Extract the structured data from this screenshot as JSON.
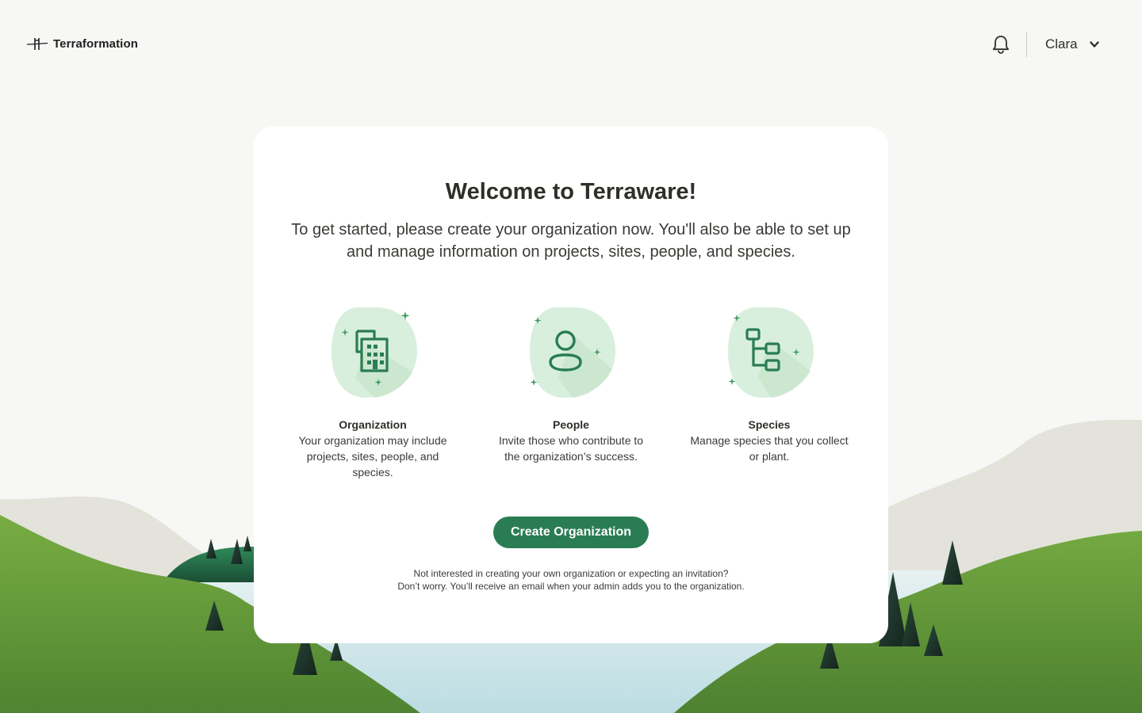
{
  "header": {
    "logo_text": "Terraformation",
    "user_name": "Clara"
  },
  "welcome": {
    "title": "Welcome to Terraware!",
    "intro": "To get started, please create your organization now. You'll also be able to set up and manage information on projects, sites, people, and species."
  },
  "features": [
    {
      "icon": "building-icon",
      "title": "Organization",
      "description": "Your organization may include projects, sites, people, and species."
    },
    {
      "icon": "person-icon",
      "title": "People",
      "description": "Invite those who contribute to the organization’s success."
    },
    {
      "icon": "hierarchy-icon",
      "title": "Species",
      "description": "Manage species that you collect or plant."
    }
  ],
  "cta": {
    "label": "Create Organization"
  },
  "note": {
    "line1": "Not interested in creating your own organization or expecting an invitation?",
    "line2": "Don’t worry. You’ll receive an email when your admin adds you to the organization."
  },
  "colors": {
    "accent": "#2a7d53",
    "background": "#f7f7f5",
    "card": "#ffffff",
    "grass": "#5f9636",
    "water": "#c6e2e6"
  }
}
